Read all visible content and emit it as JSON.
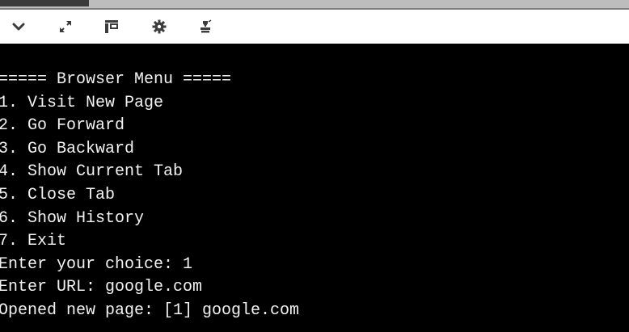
{
  "toolbar": {
    "icons": [
      "chevron-down-icon",
      "expand-icon",
      "layout-icon",
      "gear-icon",
      "stamp-icon"
    ]
  },
  "colors": {
    "terminal_bg": "#000000",
    "terminal_fg": "#f2f2f2",
    "toolbar_bg": "#ffffff",
    "icon_color": "#3c3c3c"
  },
  "terminal": {
    "lines": [
      "===== Browser Menu =====",
      "1. Visit New Page",
      "2. Go Forward",
      "3. Go Backward",
      "4. Show Current Tab",
      "5. Close Tab",
      "6. Show History",
      "7. Exit",
      "Enter your choice: 1",
      "Enter URL: google.com",
      "Opened new page: [1] google.com"
    ]
  }
}
